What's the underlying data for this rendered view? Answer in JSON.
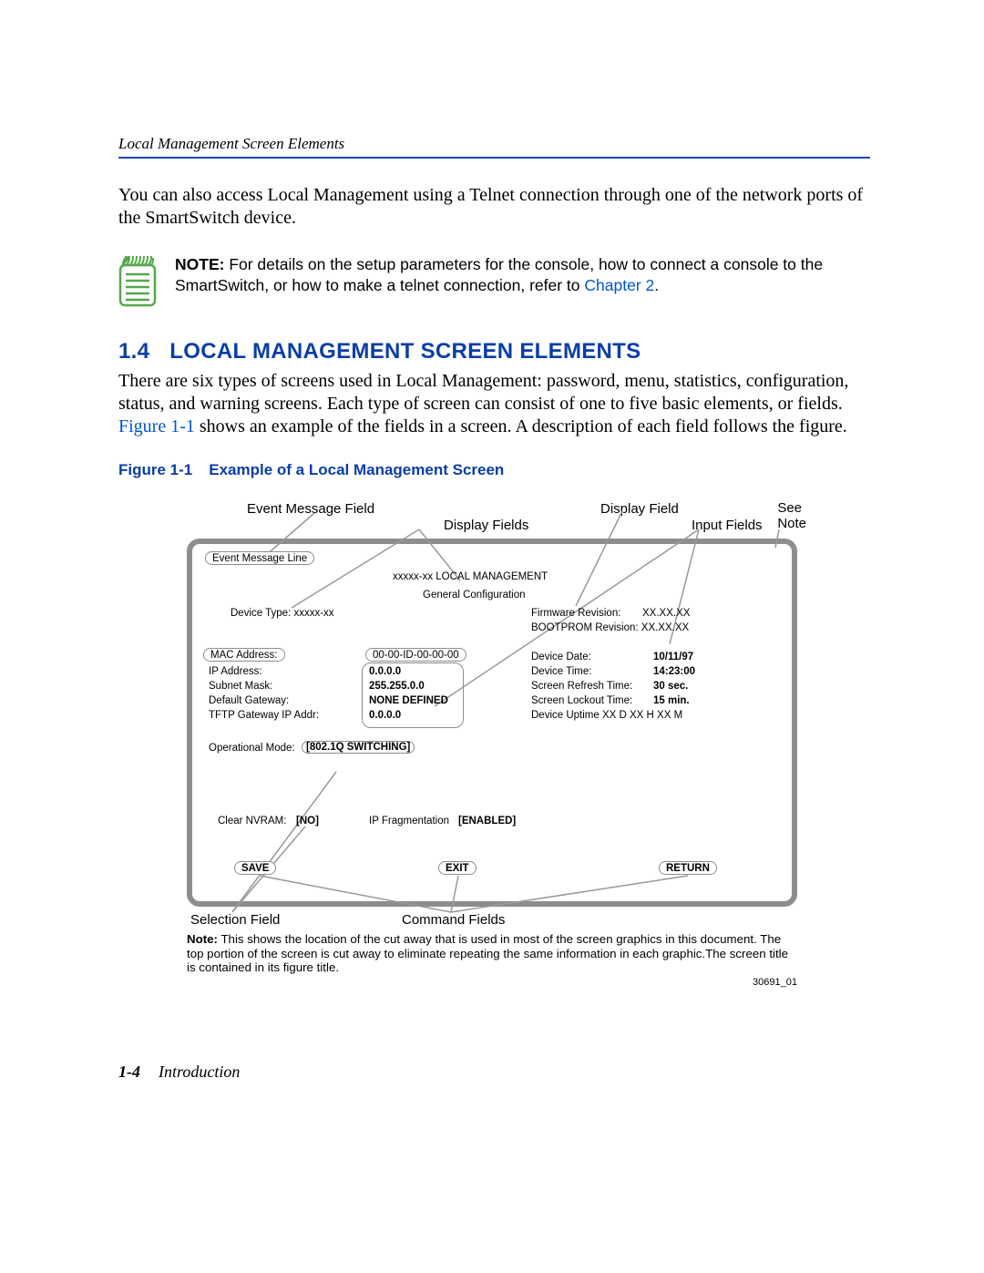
{
  "header": {
    "running": "Local Management Screen Elements"
  },
  "para1": "You can also access Local Management using a Telnet connection through one of the network ports of the SmartSwitch device.",
  "note": {
    "label": "NOTE:",
    "text_before_link": "  For details on the setup parameters for the console, how to connect a console to the SmartSwitch, or how to make a telnet connection, refer to ",
    "link": "Chapter 2",
    "period": "."
  },
  "heading": {
    "num": "1.4",
    "text": "LOCAL MANAGEMENT SCREEN ELEMENTS"
  },
  "para2_a": "There are six types of screens used in Local Management: password, menu, statistics, configuration, status, and warning screens. Each type of screen can consist of one to five basic elements, or fields. ",
  "para2_link": "Figure 1-1",
  "para2_b": " shows an example of the fields in a screen. A description of each field follows the figure.",
  "fig_caption": {
    "num": "Figure 1-1",
    "title": "Example of a Local Management Screen"
  },
  "labels": {
    "event_msg_field": "Event Message Field",
    "display_fields": "Display Fields",
    "display_field": "Display Field",
    "input_fields": "Input Fields",
    "see_note": "See\nNote",
    "selection_field": "Selection Field",
    "command_fields": "Command Fields"
  },
  "screen": {
    "event_line": "Event Message Line",
    "title": "xxxxx-xx  LOCAL MANAGEMENT",
    "subtitle": "General Configuration",
    "device_type_label": "Device Type: xxxxx-xx",
    "firmware": "Firmware Revision:",
    "firmware_v": "XX.XX.XX",
    "bootprom": "BOOTPROM Revision: XX.XX.XX",
    "rows_left": [
      {
        "label": "MAC Address:",
        "value": "00-00-ID-00-00-00"
      },
      {
        "label": "IP Address:",
        "value": "0.0.0.0"
      },
      {
        "label": "Subnet Mask:",
        "value": "255.255.0.0"
      },
      {
        "label": "Default Gateway:",
        "value": "NONE DEFINED"
      },
      {
        "label": "TFTP Gateway IP Addr:",
        "value": "0.0.0.0"
      }
    ],
    "rows_right": [
      {
        "label": "Device Date:",
        "value": "10/11/97"
      },
      {
        "label": "Device Time:",
        "value": "14:23:00"
      },
      {
        "label": "Screen Refresh Time:",
        "value": "30 sec."
      },
      {
        "label": "Screen Lockout Time:",
        "value": "15 min."
      },
      {
        "label": "Device Uptime  XX D  XX H  XX M",
        "value": ""
      }
    ],
    "op_mode_label": "Operational Mode:",
    "op_mode_value": "[802.1Q SWITCHING]",
    "clear_label": "Clear NVRAM:",
    "clear_value": "[NO]",
    "ipfrag_label": "IP Fragmentation",
    "ipfrag_value": "[ENABLED]",
    "cmd_save": "SAVE",
    "cmd_exit": "EXIT",
    "cmd_return": "RETURN"
  },
  "fig_note": {
    "label": "Note:",
    "text": " This shows the location of the cut away that is used in most of the screen graphics in this document. The top portion of the screen is cut away to eliminate repeating the same information in each graphic.The screen title is contained in its figure title."
  },
  "fig_code": "30691_01",
  "footer": {
    "page": "1-4",
    "chapter": "Introduction"
  }
}
